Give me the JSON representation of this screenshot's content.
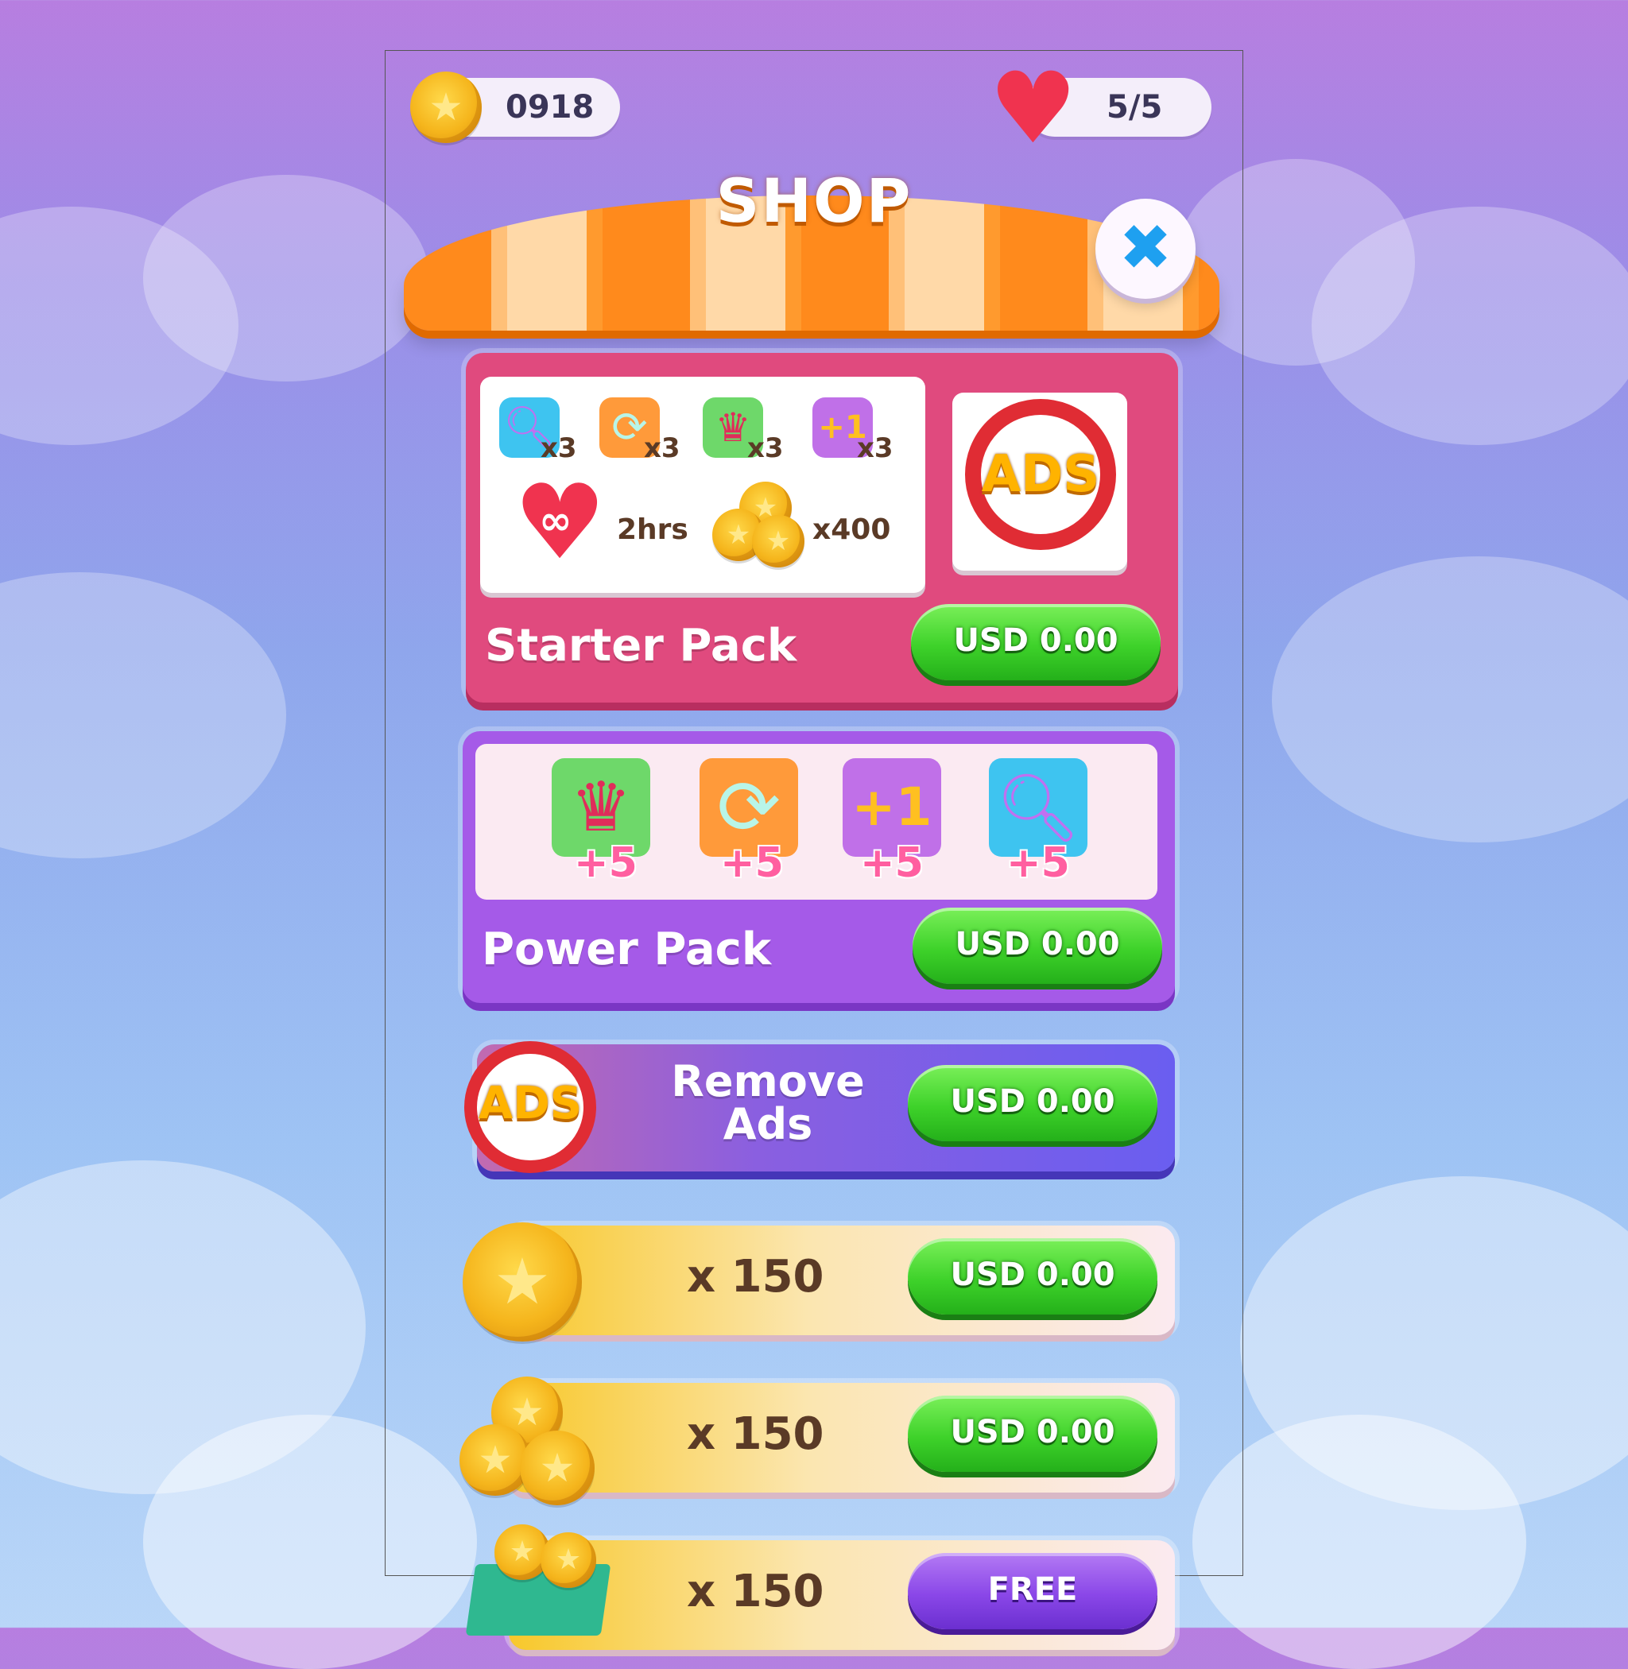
{
  "hud": {
    "coins": "0918",
    "lives": "5/5"
  },
  "header": {
    "title": "SHOP",
    "close_icon": "close-icon"
  },
  "starter_pack": {
    "title": "Starter Pack",
    "items": [
      {
        "icon": "magnifier-icon",
        "qty": "x3"
      },
      {
        "icon": "refresh-icon",
        "qty": "x3"
      },
      {
        "icon": "jester-hat-icon",
        "qty": "x3"
      },
      {
        "icon": "plus-one-icon",
        "qty": "x3"
      }
    ],
    "infinite_lives": "2hrs",
    "coins": "x400",
    "ads_label": "ADS",
    "price": "USD 0.00"
  },
  "power_pack": {
    "title": "Power Pack",
    "items": [
      {
        "icon": "jester-hat-icon",
        "qty": "+5"
      },
      {
        "icon": "refresh-icon",
        "qty": "+5"
      },
      {
        "icon": "plus-one-icon",
        "qty": "+5"
      },
      {
        "icon": "magnifier-icon",
        "qty": "+5"
      }
    ],
    "price": "USD 0.00"
  },
  "remove_ads": {
    "ads_label": "ADS",
    "title_line1": "Remove",
    "title_line2": "Ads",
    "price": "USD 0.00"
  },
  "coin_offers": [
    {
      "amount": "x 150",
      "price": "USD 0.00"
    },
    {
      "amount": "x 150",
      "price": "USD 0.00"
    },
    {
      "amount": "x 150",
      "price": "FREE"
    }
  ],
  "colors": {
    "starter_card": "#e04a7e",
    "power_card": "#a55ae8",
    "remove_ads_card": "#6a5ef0",
    "buy_green": "#3ed22a",
    "free_purple": "#8a47e8"
  }
}
